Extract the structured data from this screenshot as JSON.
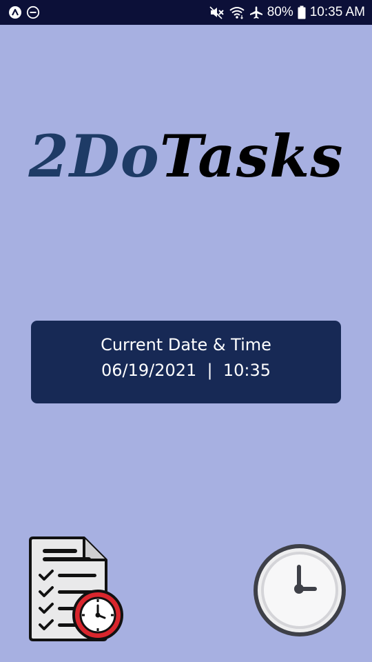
{
  "status_bar": {
    "battery_percent": "80%",
    "time": "10:35 AM",
    "icons": [
      "expo-icon",
      "do-not-disturb-icon",
      "mute-icon",
      "wifi-icon",
      "airplane-mode-icon",
      "battery-icon"
    ]
  },
  "logo": {
    "part_a": "2Do",
    "part_b": "Tasks",
    "colors": {
      "part_a": "#1e3b66",
      "part_b": "#000000"
    }
  },
  "datetime_card": {
    "label": "Current Date & Time",
    "date_time": "06/19/2021  |  10:35",
    "background": "#172955"
  },
  "bottom_actions": {
    "icons": [
      "tasks-list-icon",
      "clock-icon"
    ]
  },
  "colors": {
    "background": "#a7b0e1",
    "status_bar": "#0c1038"
  }
}
